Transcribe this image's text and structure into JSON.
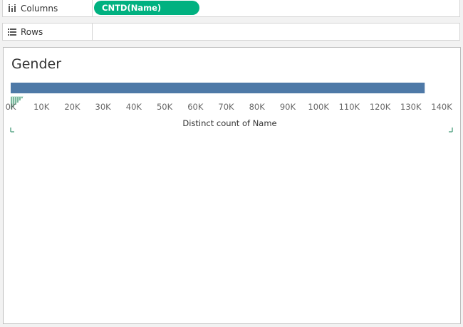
{
  "shelves": {
    "columns": {
      "label": "Columns",
      "icon": "columns-icon",
      "pills": [
        "CNTD(Name)"
      ]
    },
    "rows": {
      "label": "Rows",
      "icon": "rows-icon",
      "pills": []
    }
  },
  "colors": {
    "pill": "#00b180",
    "bar": "#4e79a7",
    "corner": "#5fa88a"
  },
  "sheet": {
    "title": "Gender"
  },
  "chart_data": {
    "type": "bar",
    "orientation": "horizontal",
    "categories": [
      ""
    ],
    "values": [
      134500
    ],
    "xlabel": "Distinct count of Name",
    "ylabel": "",
    "xlim": [
      0,
      140000
    ],
    "ticks": [
      0,
      10000,
      20000,
      30000,
      40000,
      50000,
      60000,
      70000,
      80000,
      90000,
      100000,
      110000,
      120000,
      130000,
      140000
    ],
    "tick_labels": [
      "0K",
      "10K",
      "20K",
      "30K",
      "40K",
      "50K",
      "60K",
      "70K",
      "80K",
      "90K",
      "100K",
      "110K",
      "120K",
      "130K",
      "140K"
    ],
    "grid": false,
    "legend": "none"
  }
}
